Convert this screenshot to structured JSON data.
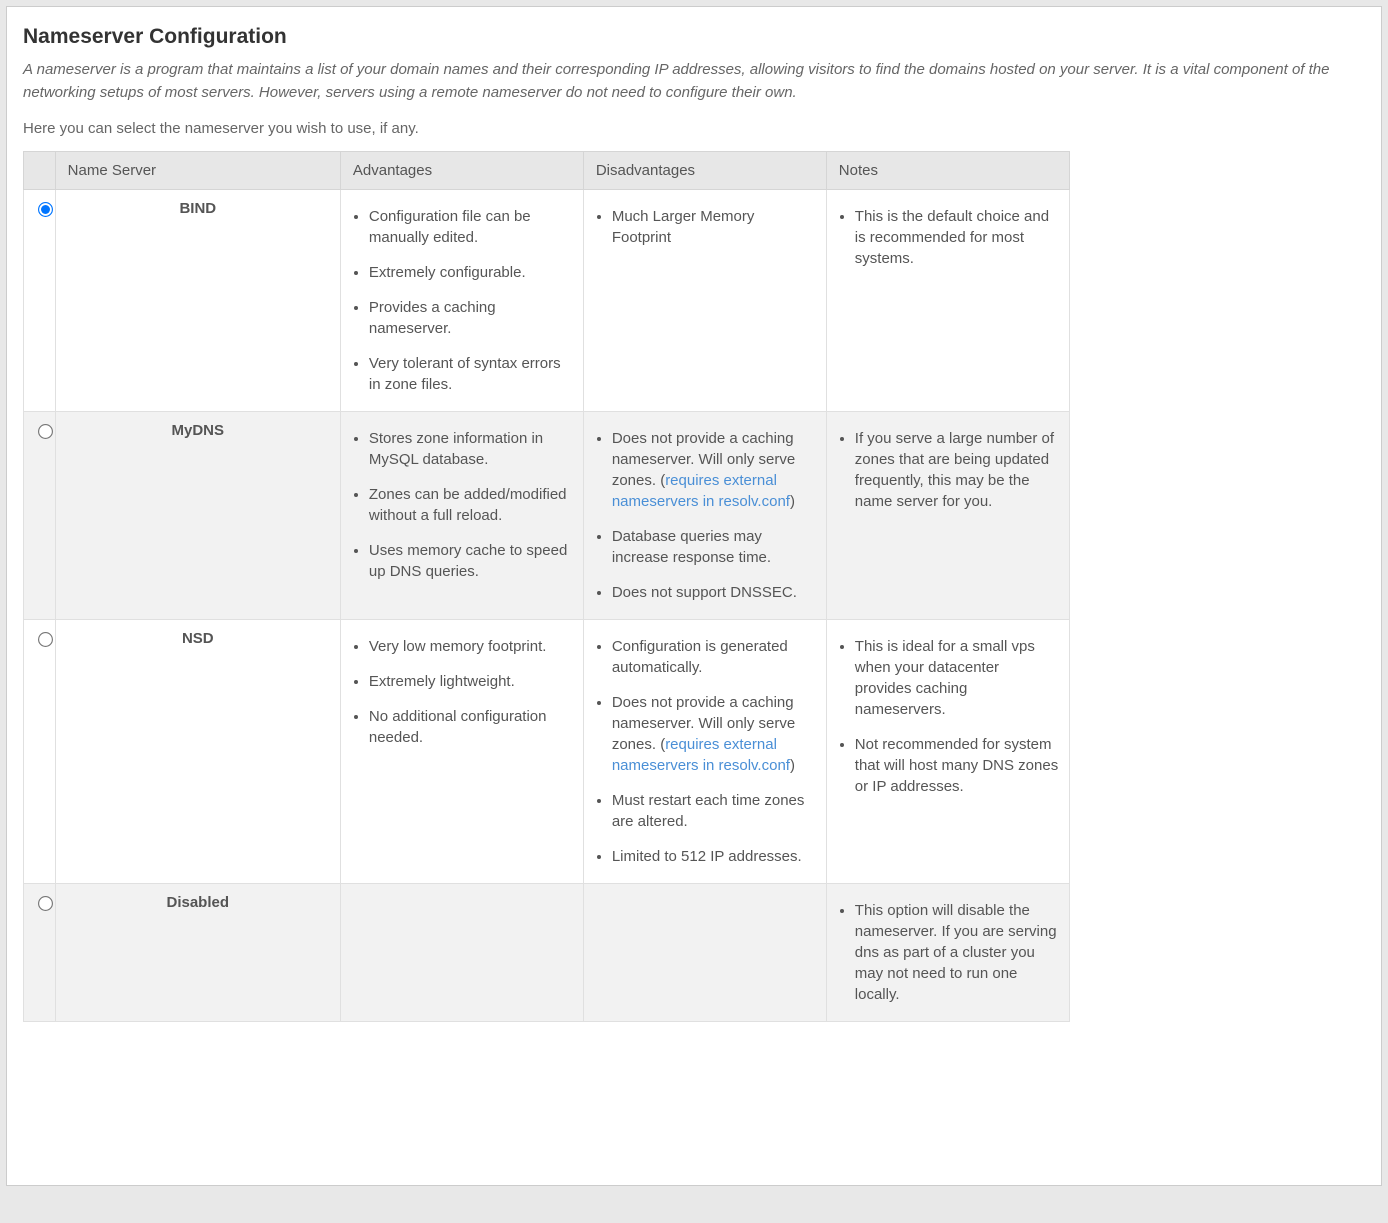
{
  "title": "Nameserver Configuration",
  "intro": "A nameserver is a program that maintains a list of your domain names and their corresponding IP addresses, allowing visitors to find the domains hosted on your server. It is a vital component of the networking setups of most servers. However, servers using a remote nameserver do not need to configure their own.",
  "instruction": "Here you can select the nameserver you wish to use, if any.",
  "headers": {
    "name": "Name Server",
    "advantages": "Advantages",
    "disadvantages": "Disadvantages",
    "notes": "Notes"
  },
  "rows": [
    {
      "id": "bind",
      "name": "BIND",
      "selected": true,
      "advantages": [
        [
          {
            "t": "text",
            "v": "Configuration file can be manually edited."
          }
        ],
        [
          {
            "t": "text",
            "v": "Extremely configurable."
          }
        ],
        [
          {
            "t": "text",
            "v": "Provides a caching nameserver."
          }
        ],
        [
          {
            "t": "text",
            "v": "Very tolerant of syntax errors in zone files."
          }
        ]
      ],
      "disadvantages": [
        [
          {
            "t": "text",
            "v": "Much Larger Memory Footprint"
          }
        ]
      ],
      "notes": [
        [
          {
            "t": "text",
            "v": "This is the default choice and is recommended for most systems."
          }
        ]
      ]
    },
    {
      "id": "mydns",
      "name": "MyDNS",
      "selected": false,
      "advantages": [
        [
          {
            "t": "text",
            "v": "Stores zone information in MySQL database."
          }
        ],
        [
          {
            "t": "text",
            "v": "Zones can be added/modified without a full reload."
          }
        ],
        [
          {
            "t": "text",
            "v": "Uses memory cache to speed up DNS queries."
          }
        ]
      ],
      "disadvantages": [
        [
          {
            "t": "text",
            "v": "Does not provide a caching nameserver. Will only serve zones. ("
          },
          {
            "t": "link",
            "v": "requires external nameservers in resolv.conf"
          },
          {
            "t": "text",
            "v": ")"
          }
        ],
        [
          {
            "t": "text",
            "v": "Database queries may increase response time."
          }
        ],
        [
          {
            "t": "text",
            "v": "Does not support DNSSEC."
          }
        ]
      ],
      "notes": [
        [
          {
            "t": "text",
            "v": "If you serve a large number of zones that are being updated frequently, this may be the name server for you."
          }
        ]
      ]
    },
    {
      "id": "nsd",
      "name": "NSD",
      "selected": false,
      "advantages": [
        [
          {
            "t": "text",
            "v": "Very low memory footprint."
          }
        ],
        [
          {
            "t": "text",
            "v": "Extremely lightweight."
          }
        ],
        [
          {
            "t": "text",
            "v": "No additional configuration needed."
          }
        ]
      ],
      "disadvantages": [
        [
          {
            "t": "text",
            "v": "Configuration is generated automatically."
          }
        ],
        [
          {
            "t": "text",
            "v": "Does not provide a caching nameserver. Will only serve zones. ("
          },
          {
            "t": "link",
            "v": "requires external nameservers in resolv.conf"
          },
          {
            "t": "text",
            "v": ")"
          }
        ],
        [
          {
            "t": "text",
            "v": "Must restart each time zones are altered."
          }
        ],
        [
          {
            "t": "text",
            "v": "Limited to 512 IP addresses."
          }
        ]
      ],
      "notes": [
        [
          {
            "t": "text",
            "v": "This is ideal for a small vps when your datacenter provides caching nameservers."
          }
        ],
        [
          {
            "t": "text",
            "v": "Not recommended for system that will host many DNS zones or IP addresses."
          }
        ]
      ]
    },
    {
      "id": "disabled",
      "name": "Disabled",
      "selected": false,
      "advantages": [],
      "disadvantages": [],
      "notes": [
        [
          {
            "t": "text",
            "v": "This option will disable the nameserver. If you are serving dns as part of a cluster you may not need to run one locally."
          }
        ]
      ]
    }
  ]
}
